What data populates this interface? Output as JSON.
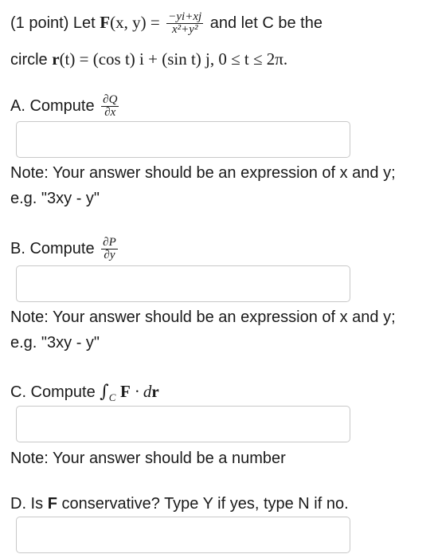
{
  "header": {
    "points": "(1 point) Let",
    "field_lhs": "F",
    "field_args": "(x, y) =",
    "frac_num": "−yi+xj",
    "frac_den": "x²+y²",
    "and_let": "and let C be the",
    "circle_word": "circle",
    "curve_r": "r",
    "curve_def": "(t) = (cos t) i + (sin t) j, 0 ≤ t ≤ 2π."
  },
  "part_a": {
    "label": "A. Compute",
    "frac_num": "∂Q",
    "frac_den": "∂x",
    "answer_value": "",
    "note": "Note: Your answer should be an expression of x and y; e.g. \"3xy - y\""
  },
  "part_b": {
    "label": "B. Compute",
    "frac_num": "∂P",
    "frac_den": "∂y",
    "answer_value": "",
    "note": "Note: Your answer should be an expression of x and y; e.g. \"3xy - y\""
  },
  "part_c": {
    "label": "C. Compute",
    "integral": "∫",
    "subscript": "C",
    "expr_F": "F",
    "expr_rest": "· d",
    "expr_r": "r",
    "answer_value": "",
    "note": "Note: Your answer should be a number"
  },
  "part_d": {
    "label_pre": "D. Is",
    "label_F": "F",
    "label_post": "conservative? Type Y if yes, type N if no.",
    "answer_value": ""
  }
}
